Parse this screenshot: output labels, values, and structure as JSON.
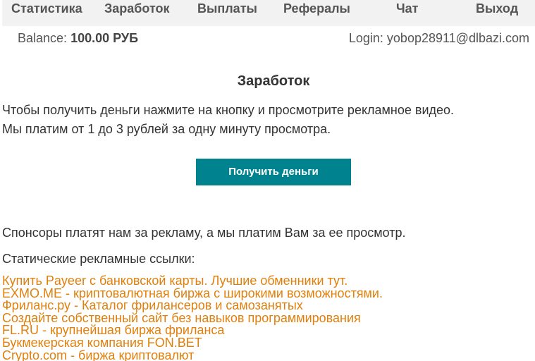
{
  "nav": {
    "items": [
      {
        "label": "Статистика"
      },
      {
        "label": "Заработок"
      },
      {
        "label": "Выплаты"
      },
      {
        "label": "Рефералы"
      },
      {
        "label": "Чат"
      },
      {
        "label": "Выход"
      }
    ]
  },
  "account": {
    "balance_label": "Balance:",
    "balance_value": "100.00 РУБ",
    "login_text": "Login: yobop28911@dlbazi.com"
  },
  "main": {
    "title": "Заработок",
    "intro_line1": "Чтобы получить деньги нажмите на кнопку и просмотрите рекламное видео.",
    "intro_line2": "Мы платим от 1 до 3 рублей за одну минуту просмотра.",
    "earn_button_label": "Получить деньги",
    "sponsors_text": "Спонсоры платят нам за рекламу, а мы платим Вам за ее просмотр.",
    "static_links_heading": "Статические рекламные ссылки:"
  },
  "ad_links": [
    {
      "text": "Купить Payeer с банковской карты. Лучшие обменники тут."
    },
    {
      "text": "EXMO.ME - криптовалютная биржа с широкими возможностями."
    },
    {
      "text": "Фриланс.ру - Каталог фрилансеров и самозанятых"
    },
    {
      "text": "Создайте собственный сайт без навыков программирования"
    },
    {
      "text": "FL.RU - крупнейшая биржа фриланса"
    },
    {
      "text": "Букмекерская компания FON.BET"
    },
    {
      "text": "Crypto.com - биржа криптовалют"
    }
  ],
  "colors": {
    "nav_background": "#f2f2f2",
    "button_background": "#00838f",
    "link_color": "#e07f0c"
  }
}
